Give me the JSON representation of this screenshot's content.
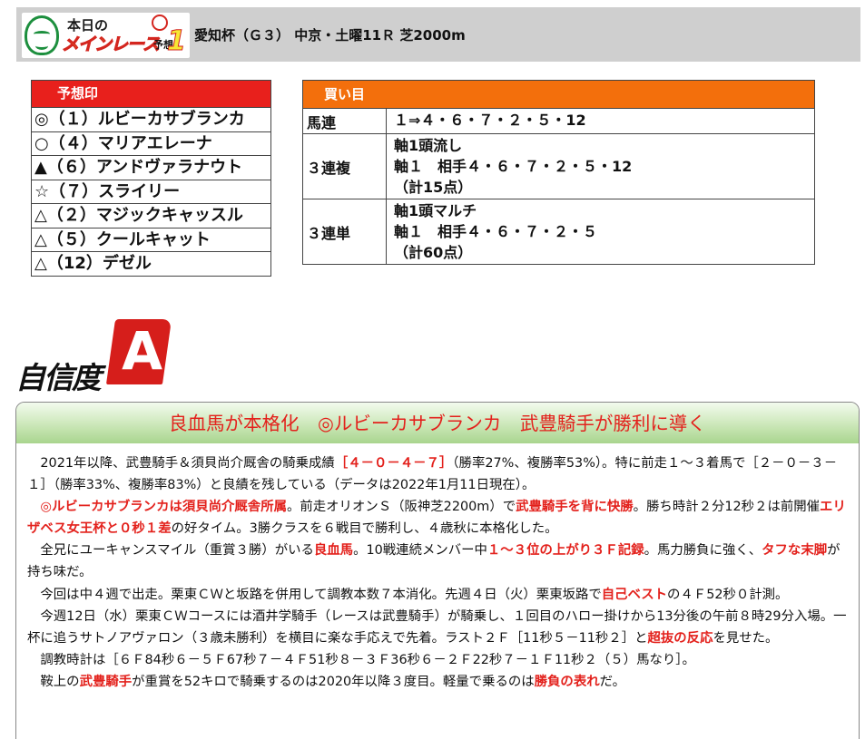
{
  "header": {
    "logo": {
      "top": "本日の",
      "main": "メインレース",
      "sub": "予想",
      "num": "1"
    },
    "title": "愛知杯（Ｇ３） 中京・土曜11Ｒ 芝2000m"
  },
  "marks": {
    "heading": "予想印",
    "rows": [
      "◎（１）ルビーカサブランカ",
      "○（４）マリアエレーナ",
      "▲（６）アンドヴァラナウト",
      "☆（７）スライリー",
      "△（２）マジックキャッスル",
      "△（５）クールキャット",
      "△（12）デゼル"
    ]
  },
  "bets": {
    "heading": "買い目",
    "rows": [
      {
        "label": "馬連",
        "lines": [
          "１⇒４・６・７・２・５・12"
        ]
      },
      {
        "label": "３連複",
        "lines": [
          "軸1頭流し",
          "軸１　相手４・６・７・２・５・12",
          "（計15点）"
        ]
      },
      {
        "label": "３連単",
        "lines": [
          "軸1頭マルチ",
          "軸１　相手４・６・７・２・５",
          "（計60点）"
        ]
      }
    ]
  },
  "confidence": {
    "word": "自信度",
    "grade": "A"
  },
  "article": {
    "headline": "良血馬が本格化　◎ルビーカサブランカ　武豊騎手が勝利に導く",
    "paragraphs": [
      [
        {
          "t": "2021年以降、武豊騎手＆須貝尚介厩舎の騎乗成績"
        },
        {
          "t": "［４－０－４－７］",
          "r": 1
        },
        {
          "t": "（勝率27%、複勝率53%）。特に前走１～３着馬で［２－０－３－１］（勝率33%、複勝率83%）と良績を残している（データは2022年1月11日現在）。"
        }
      ],
      [
        {
          "t": "◎ルビーカサブランカは須貝尚介厩舎所属",
          "r": 1
        },
        {
          "t": "。前走オリオンＳ（阪神芝2200m）で"
        },
        {
          "t": "武豊騎手を背に快勝",
          "r": 1
        },
        {
          "t": "。勝ち時計２分12秒２は前開催"
        },
        {
          "t": "エリザベス女王杯と０秒１差",
          "r": 1
        },
        {
          "t": "の好タイム。3勝クラスを６戦目で勝利し、４歳秋に本格化した。"
        }
      ],
      [
        {
          "t": "全兄にユーキャンスマイル（重賞３勝）がいる"
        },
        {
          "t": "良血馬",
          "r": 1
        },
        {
          "t": "。10戦連続メンバー中"
        },
        {
          "t": "１～３位の上がり３Ｆ記録",
          "r": 1
        },
        {
          "t": "。馬力勝負に強く、"
        },
        {
          "t": "タフな末脚",
          "r": 1
        },
        {
          "t": "が持ち味だ。"
        }
      ],
      [
        {
          "t": "今回は中４週で出走。栗東ＣＷと坂路を併用して調教本数７本消化。先週４日（火）栗東坂路で"
        },
        {
          "t": "自己ベスト",
          "r": 1
        },
        {
          "t": "の４Ｆ52秒０計測。"
        }
      ],
      [
        {
          "t": "今週12日（水）栗東ＣＷコースには酒井学騎手（レースは武豊騎手）が騎乗し、１回目のハロー掛けから13分後の午前８時29分入場。一杯に追うサトノアヴァロン（３歳未勝利）を横目に楽な手応えで先着。ラスト２Ｆ［11秒５－11秒２］と"
        },
        {
          "t": "超抜の反応",
          "r": 1
        },
        {
          "t": "を見せた。"
        }
      ],
      [
        {
          "t": "調教時計は［６Ｆ84秒６－５Ｆ67秒７－４Ｆ51秒８－３Ｆ36秒６－２Ｆ22秒７－１Ｆ11秒２（５）馬なり］。"
        }
      ],
      [
        {
          "t": "鞍上の"
        },
        {
          "t": "武豊騎手",
          "r": 1
        },
        {
          "t": "が重賞を52キロで騎乗するのは2020年以降３度目。軽量で乗るのは"
        },
        {
          "t": "勝負の表れ",
          "r": 1
        },
        {
          "t": "だ。"
        }
      ]
    ]
  }
}
